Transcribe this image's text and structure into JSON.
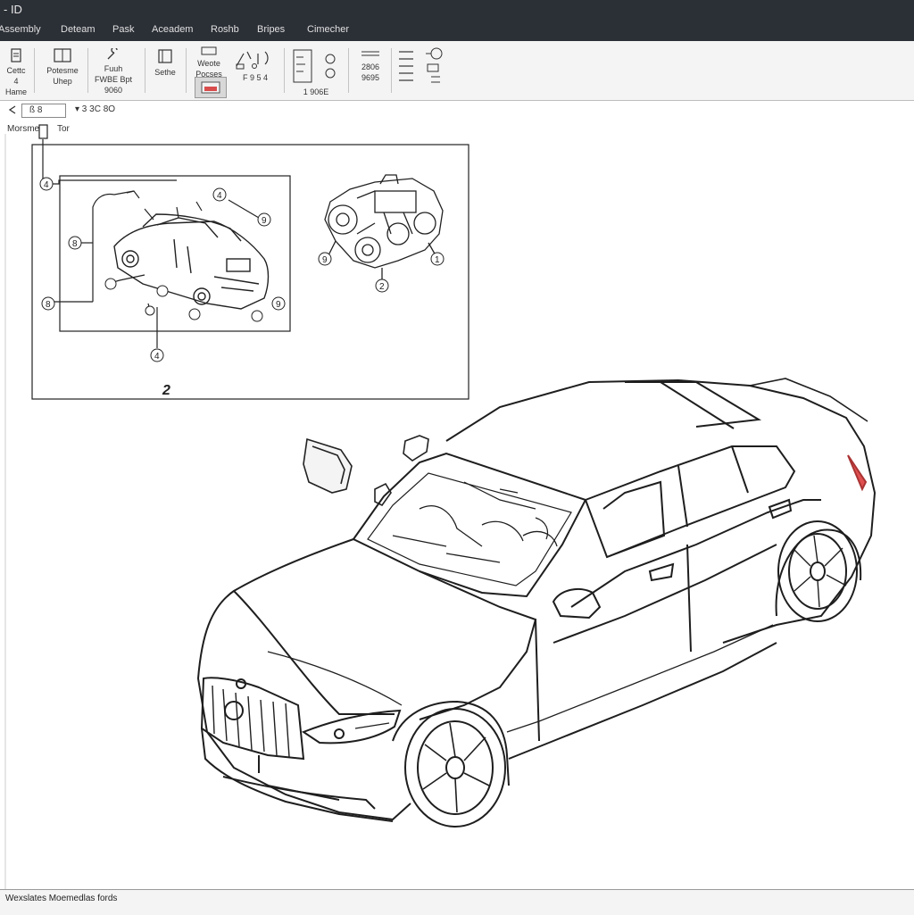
{
  "window": {
    "title": "- ID"
  },
  "menu": [
    "Assembly",
    "Deteam",
    "Pask",
    "Aceadem",
    "Roshb",
    "Bripes",
    "Cimecher"
  ],
  "ribbon": {
    "b1": [
      "Cettc",
      "4 Hame"
    ],
    "b2": [
      "Potesme",
      "Uhep"
    ],
    "b3": [
      "Fuuh",
      "FWBE Bpt",
      "9060"
    ],
    "b4": [
      "Sethe"
    ],
    "b5": [
      "Weote",
      "Pocses"
    ],
    "b6": [
      "F 9",
      "5 4"
    ],
    "b7": [
      "1 906E"
    ],
    "b8": [
      "2806",
      "9695"
    ]
  },
  "subtoolbar": {
    "zoom_field": "ß 8",
    "zoom_value": "▾ 3 3C 8O",
    "mode_label": "Morsmer",
    "tab_label": "Tor"
  },
  "inset": {
    "title": "2"
  },
  "callouts": {
    "c_top": "4",
    "c_left": "8",
    "c_left_b": "8",
    "c_right": "9",
    "c_bottom": "4",
    "c_bottom_b": "8",
    "c_under": "8",
    "e_left": "9",
    "e_right": "1",
    "e_bottom": "2"
  },
  "status": {
    "text": "Wexslates Moemedlas fords"
  }
}
